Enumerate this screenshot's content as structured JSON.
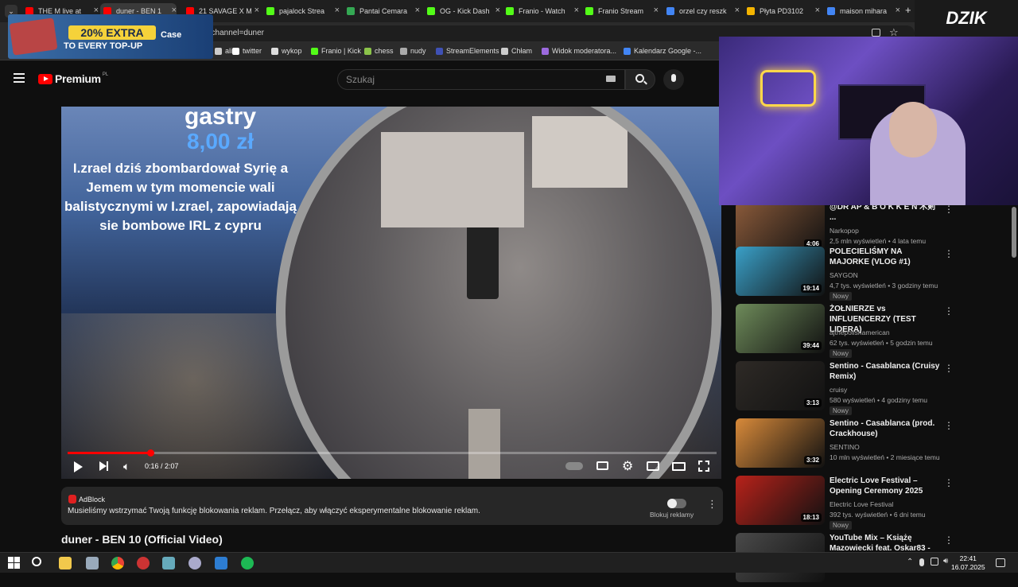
{
  "browser": {
    "tabs": [
      {
        "label": "THE M live at",
        "color": "#ff0000"
      },
      {
        "label": "duner - BEN 1",
        "color": "#ff0000",
        "active": true
      },
      {
        "label": "21 SAVAGE X M",
        "color": "#ff0000"
      },
      {
        "label": "pajalock Strea",
        "color": "#53fc18"
      },
      {
        "label": "Pantai Cemara",
        "color": "#34a853"
      },
      {
        "label": "OG - Kick Dash",
        "color": "#53fc18"
      },
      {
        "label": "Franio - Watch",
        "color": "#53fc18"
      },
      {
        "label": "Franio Stream",
        "color": "#53fc18"
      },
      {
        "label": "orzel czy reszk",
        "color": "#4285f4"
      },
      {
        "label": "Płyta PD3102",
        "color": "#f4b400"
      },
      {
        "label": "maison mihara",
        "color": "#4285f4"
      }
    ],
    "new_tab_glyph": "+",
    "url": "_channel=duner",
    "bookmarks": [
      {
        "label": "alior"
      },
      {
        "label": "twitter"
      },
      {
        "label": "wykop"
      },
      {
        "label": "Franio | Kick"
      },
      {
        "label": "chess"
      },
      {
        "label": "nudy"
      },
      {
        "label": "StreamElements"
      },
      {
        "label": "Chłam"
      },
      {
        "label": "Widok moderatora..."
      },
      {
        "label": "Kalendarz Google -..."
      }
    ]
  },
  "ad_banner": {
    "headline": "20% EXTRA",
    "subline": "TO EVERY TOP-UP",
    "brand": "Case"
  },
  "youtube": {
    "logo_text": "Premium",
    "logo_region": "PL",
    "search_placeholder": "Szukaj"
  },
  "video": {
    "overlay": {
      "line1": "gastry",
      "price": "8,00 zł",
      "message": "I.zrael dziś zbombardował Syrię a Jemem w tym momencie wali balistycznymi w I.zrael, zapowiadają sie bombowe IRL z cypru"
    },
    "progress": 0.128,
    "time": "0:16 / 2:07",
    "title": "duner - BEN 10 (Official Video)"
  },
  "adblock_notice": {
    "title": "AdBlock",
    "message": "Musieliśmy wstrzymać Twoją funkcję blokowania reklam. Przełącz, aby włączyć eksperymentalne blokowanie reklam.",
    "toggle_label": "Blokuj reklamy"
  },
  "recommendations": [
    {
      "title": "@DR AP & B O K K E N 木剣 ...",
      "channel": "Narkopop",
      "meta": "2,5 mln wyświetleń • 4 lata temu",
      "duration": "4:06",
      "badge": "",
      "thumb": "#8a5a3a"
    },
    {
      "title": "POLECIELIŚMY NA MAJORKE (VLOG #1)",
      "channel": "SAYGON",
      "meta": "4,7 tys. wyświetleń • 3 godziny temu",
      "duration": "19:14",
      "badge": "Nowy",
      "thumb": "#3aa0c8"
    },
    {
      "title": "ŻOŁNIERZE vs INFLUENCERZY (TEST LIDERA)",
      "channel": "ajthepolishamerican",
      "meta": "62 tys. wyświetleń • 5 godzin temu",
      "duration": "39:44",
      "badge": "Nowy",
      "thumb": "#6e8b5a"
    },
    {
      "title": "Sentino - Casablanca (Cruisy Remix)",
      "channel": "cruisy",
      "meta": "580 wyświetleń • 4 godziny temu",
      "duration": "3:13",
      "badge": "Nowy",
      "thumb": "#2e2a26"
    },
    {
      "title": "Sentino - Casablanca (prod. Crackhouse)",
      "channel": "SENTINO",
      "meta": "10 mln wyświetleń • 2 miesiące temu",
      "duration": "3:32",
      "badge": "",
      "thumb": "#d88a3a"
    },
    {
      "title": "Electric Love Festival – Opening Ceremony 2025",
      "channel": "Electric Love Festival",
      "meta": "392 tys. wyświetleń • 6 dni temu",
      "duration": "18:13",
      "badge": "Nowy",
      "thumb": "#b8221a"
    },
    {
      "title": "YouTube Mix – Książę Mazowiecki feat. Oskar83 -",
      "channel": "",
      "meta": "",
      "duration": "",
      "badge": "",
      "thumb": "#4a4a4a"
    }
  ],
  "stream_overlay": {
    "logo": "DZIK"
  },
  "taskbar": {
    "time": "22:41",
    "date": "16.07.2025"
  }
}
